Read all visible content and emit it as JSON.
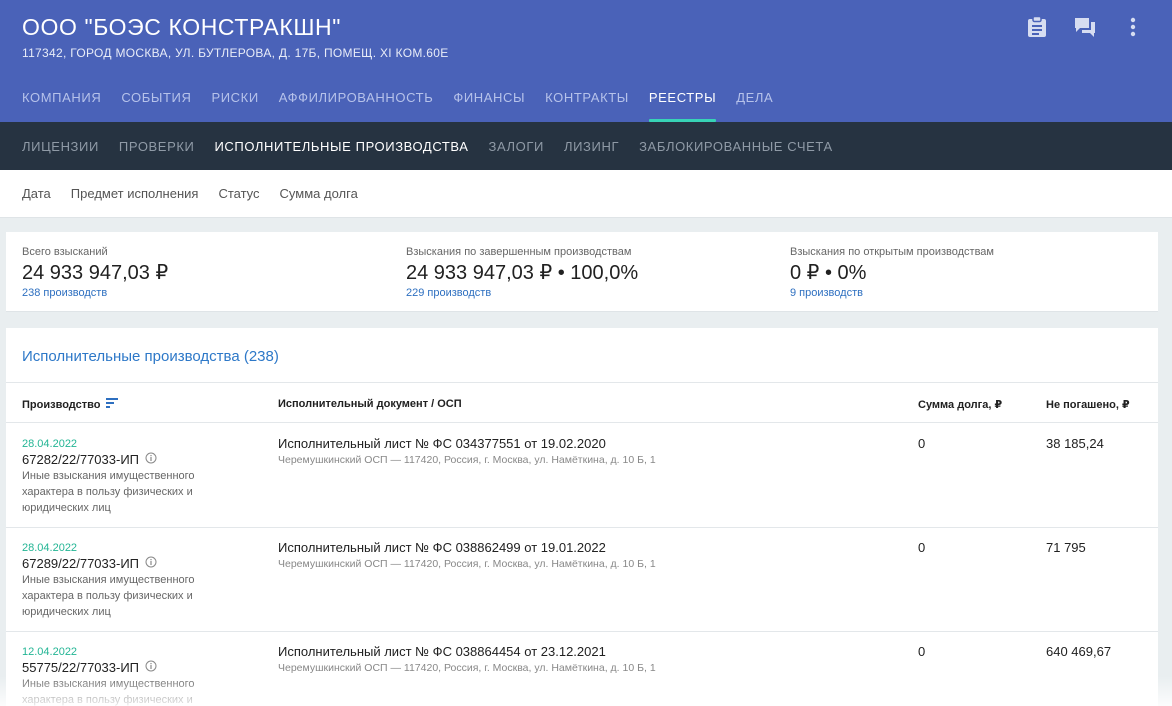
{
  "company": {
    "title": "ООО \"БОЭС КОНСТРАКШН\"",
    "address": "117342, ГОРОД МОСКВА, УЛ. БУТЛЕРОВА, Д. 17Б, ПОМЕЩ. XI КОМ.60Е"
  },
  "header_icons": [
    "clipboard-icon",
    "chat-icon",
    "more-vert-icon"
  ],
  "main_tabs": [
    "КОМПАНИЯ",
    "СОБЫТИЯ",
    "РИСКИ",
    "АФФИЛИРОВАННОСТЬ",
    "ФИНАНСЫ",
    "КОНТРАКТЫ",
    "РЕЕСТРЫ",
    "ДЕЛА"
  ],
  "main_tab_active": "РЕЕСТРЫ",
  "sub_tabs": [
    "ЛИЦЕНЗИИ",
    "ПРОВЕРКИ",
    "ИСПОЛНИТЕЛЬНЫЕ ПРОИЗВОДСТВА",
    "ЗАЛОГИ",
    "ЛИЗИНГ",
    "ЗАБЛОКИРОВАННЫЕ СЧЕТА"
  ],
  "sub_tab_active": "ИСПОЛНИТЕЛЬНЫЕ ПРОИЗВОДСТВА",
  "filters": [
    "Дата",
    "Предмет исполнения",
    "Статус",
    "Сумма долга"
  ],
  "summary": [
    {
      "label": "Всего взысканий",
      "value": "24 933 947,03 ₽",
      "link": "238 производств"
    },
    {
      "label": "Взыскания по завершенным производствам",
      "value": "24 933 947,03 ₽ • 100,0%",
      "link": "229 производств"
    },
    {
      "label": "Взыскания по открытым производствам",
      "value": "0 ₽ • 0%",
      "link": "9 производств"
    }
  ],
  "table": {
    "title": "Исполнительные производства (238)",
    "headers": {
      "proceeding": "Производство",
      "document": "Исполнительный документ / ОСП",
      "debt": "Сумма долга, ₽",
      "unpaid": "Не погашено, ₽"
    },
    "rows": [
      {
        "date": "28.04.2022",
        "number": "67282/22/77033-ИП",
        "description": "Иные взыскания имущественного характера в пользу физических и юридических лиц",
        "doc_title": "Исполнительный лист № ФС 034377551 от 19.02.2020",
        "doc_osp": "Черемушкинский ОСП — 117420, Россия, г. Москва, ул. Намёткина, д. 10 Б, 1",
        "debt": "0",
        "unpaid": "38 185,24"
      },
      {
        "date": "28.04.2022",
        "number": "67289/22/77033-ИП",
        "description": "Иные взыскания имущественного характера в пользу физических и юридических лиц",
        "doc_title": "Исполнительный лист № ФС 038862499 от 19.01.2022",
        "doc_osp": "Черемушкинский ОСП — 117420, Россия, г. Москва, ул. Намёткина, д. 10 Б, 1",
        "debt": "0",
        "unpaid": "71 795"
      },
      {
        "date": "12.04.2022",
        "number": "55775/22/77033-ИП",
        "description": "Иные взыскания имущественного характера в пользу физических и юридических лиц",
        "doc_title": "Исполнительный лист № ФС 038864454 от 23.12.2021",
        "doc_osp": "Черемушкинский ОСП — 117420, Россия, г. Москва, ул. Намёткина, д. 10 Б, 1",
        "debt": "0",
        "unpaid": "640 469,67"
      }
    ]
  },
  "colors": {
    "header_bg": "#4a62b8",
    "subnav_bg": "#263341",
    "active_indicator": "#37d3b6",
    "link": "#2d6fc0",
    "date": "#23b594"
  }
}
